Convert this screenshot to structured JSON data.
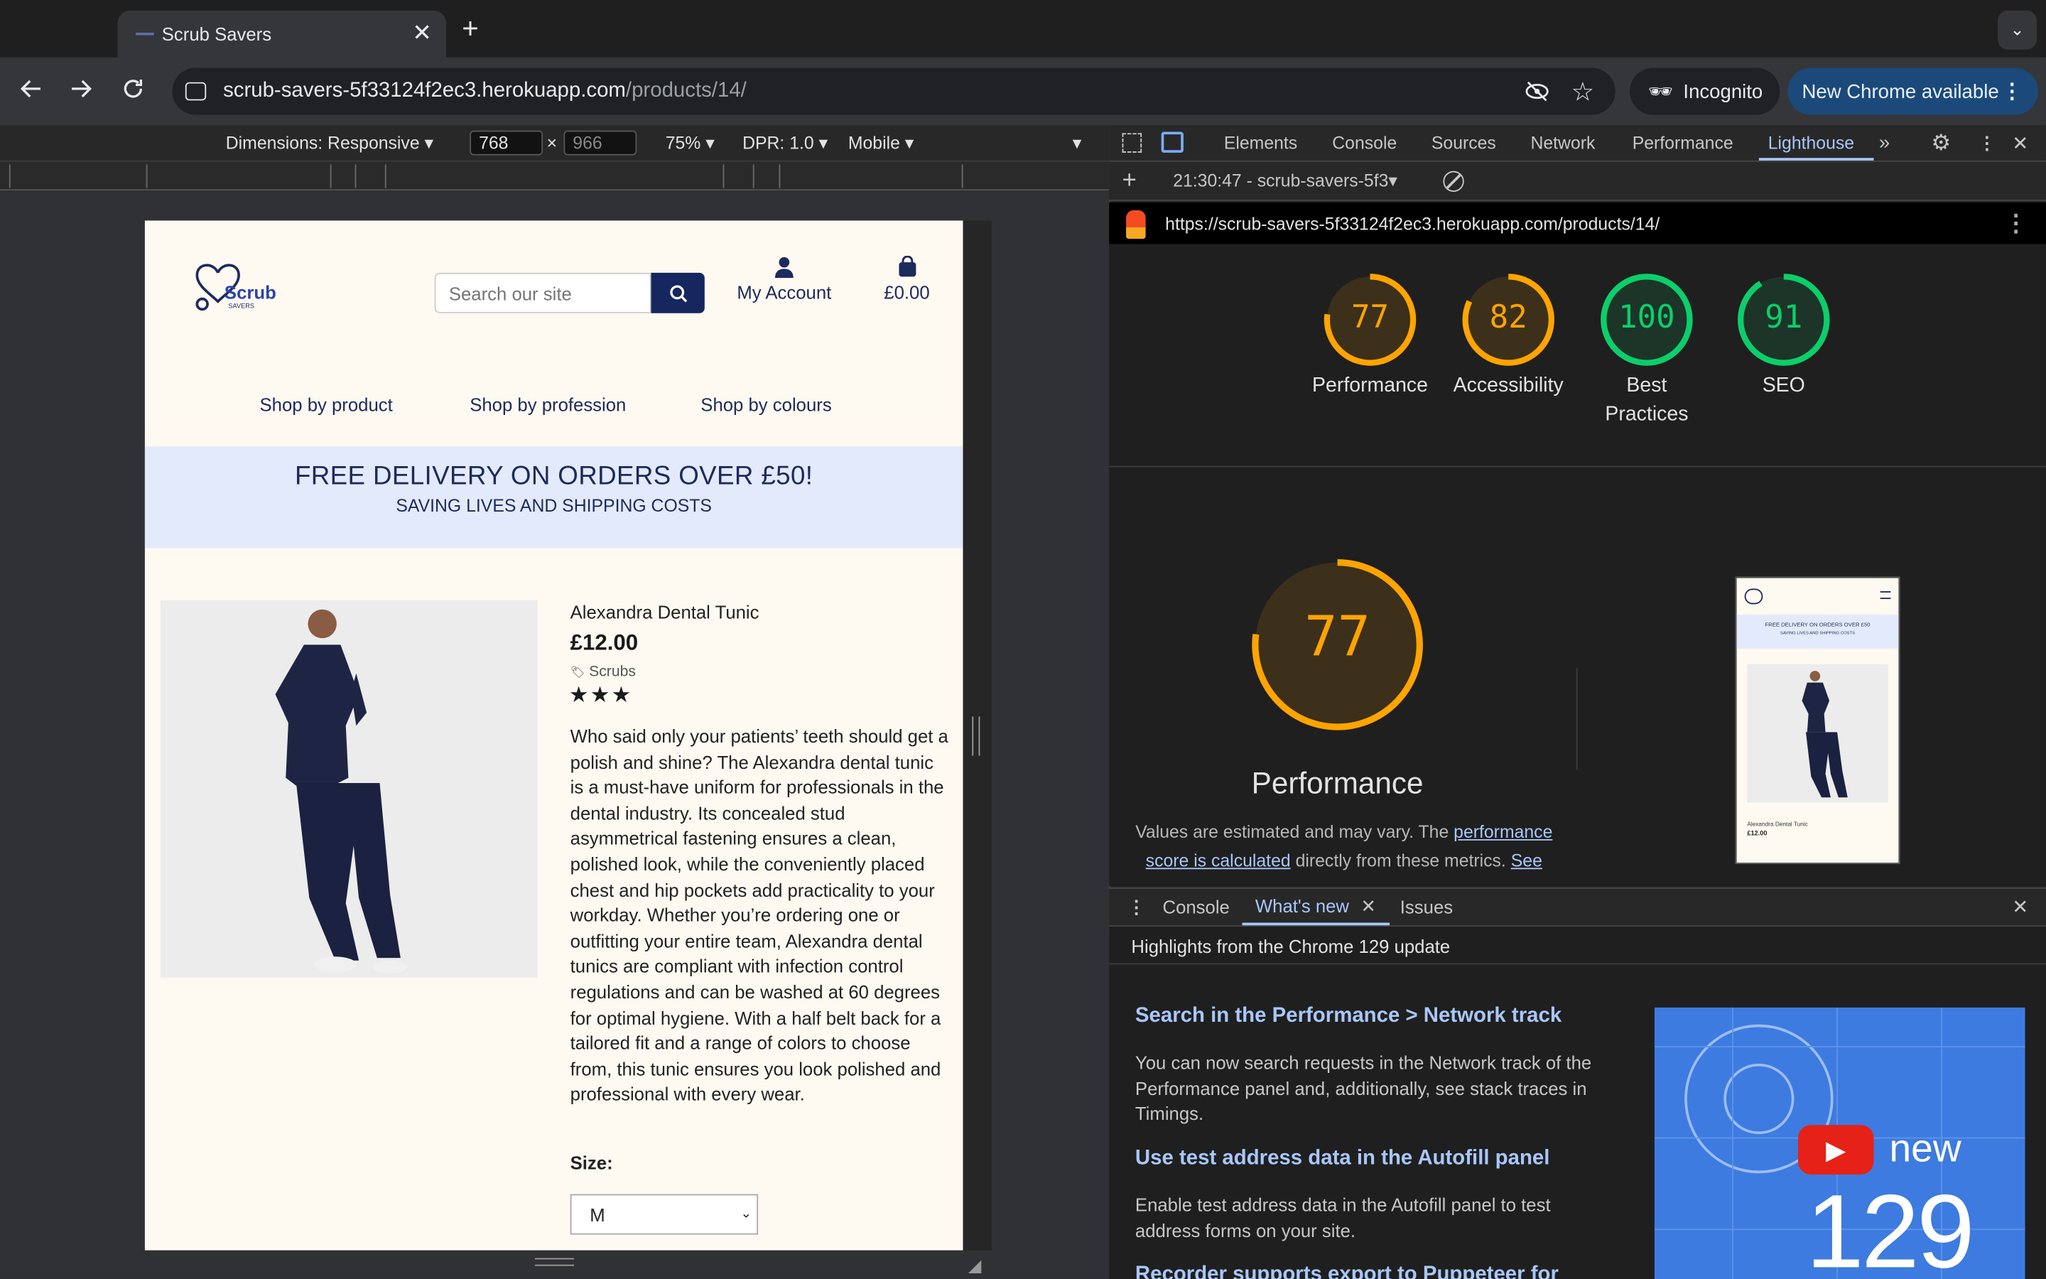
{
  "browser": {
    "tab_title": "Scrub Savers",
    "url_host": "scrub-savers-5f33124f2ec3.herokuapp.com",
    "url_path": "/products/14/",
    "incognito_label": "Incognito",
    "update_label": "New Chrome available"
  },
  "emulation": {
    "dimensions": "Dimensions: Responsive",
    "width": "768",
    "height": "966",
    "zoom": "75%",
    "dpr": "DPR: 1.0",
    "device_type": "Mobile"
  },
  "site": {
    "logo_text": "Scrub",
    "logo_sub": "SAVERS",
    "search_placeholder": "Search our site",
    "account_label": "My Account",
    "basket_total": "£0.00",
    "nav": [
      "Shop by product",
      "Shop by profession",
      "Shop by colours"
    ],
    "banner_title": "FREE DELIVERY ON ORDERS OVER £50!",
    "banner_sub": "SAVING LIVES AND SHIPPING COSTS",
    "product": {
      "name": "Alexandra Dental Tunic",
      "price": "£12.00",
      "category": "Scrubs",
      "rating_stars": 3,
      "description": "Who said only your patients’ teeth should get a polish and shine? The Alexandra dental tunic is a must-have uniform for professionals in the dental industry. Its concealed stud asymmetrical fastening ensures a clean, polished look, while the conveniently placed chest and hip pockets add practicality to your workday. Whether you’re ordering one or outfitting your entire team, Alexandra dental tunics are compliant with infection control regulations and can be washed at 60 degrees for optimal hygiene. With a half belt back for a tailored fit and a range of colors to choose from, this tunic ensures you look polished and professional with every wear.",
      "size_label": "Size:",
      "size_value": "M"
    }
  },
  "devtools": {
    "tabs": [
      "Elements",
      "Console",
      "Sources",
      "Network",
      "Performance",
      "Lighthouse"
    ],
    "active_tab": "Lighthouse",
    "report_select": "21:30:47 - scrub-savers-5f3",
    "report_url": "https://scrub-savers-5f33124f2ec3.herokuapp.com/products/14/",
    "scores": [
      {
        "label": "Performance",
        "value": 77,
        "display": "77",
        "color": "#ffa400"
      },
      {
        "label": "Accessibility",
        "value": 82,
        "display": "82",
        "color": "#ffa400"
      },
      {
        "label": "Best Practices",
        "value": 100,
        "display": "100",
        "color": "#0cce6b"
      },
      {
        "label": "SEO",
        "value": 91,
        "display": "91",
        "color": "#0cce6b"
      }
    ],
    "big_score": {
      "label": "Performance",
      "value": 77,
      "display": "77"
    },
    "estimate_text": "Values are estimated and may vary. The",
    "estimate_link": "performance score is calculated",
    "estimate_tail": "directly from these metrics.",
    "see_link": "See",
    "thumb_banner": "FREE DELIVERY ON ORDERS OVER £50",
    "thumb_banner_sub": "SAVING LIVES AND SHIPPING COSTS",
    "thumb_name": "Alexandra Dental Tunic",
    "thumb_price": "£12.00",
    "drawer_tabs": [
      "Console",
      "What's new",
      "Issues"
    ],
    "drawer_active": "What's new",
    "whats_new_title": "Highlights from the Chrome 129 update",
    "items": [
      {
        "title": "Search in the Performance > Network track",
        "body": "You can now search requests in the Network track of the Performance panel and, additionally, see stack traces in Timings."
      },
      {
        "title": "Use test address data in the Autofill panel",
        "body": "Enable test address data in the Autofill panel to test address forms on your site."
      },
      {
        "title": "Recorder supports export to Puppeteer for",
        "body": ""
      }
    ],
    "video_new": "new",
    "video_version": "129"
  },
  "colors": {
    "navy": "#1d2a5c",
    "banner_bg": "#e3eafb",
    "page_bg": "#fef9f1",
    "score_orange": "#ffa400",
    "score_green": "#0cce6b",
    "link_blue": "#a8c7fa"
  }
}
